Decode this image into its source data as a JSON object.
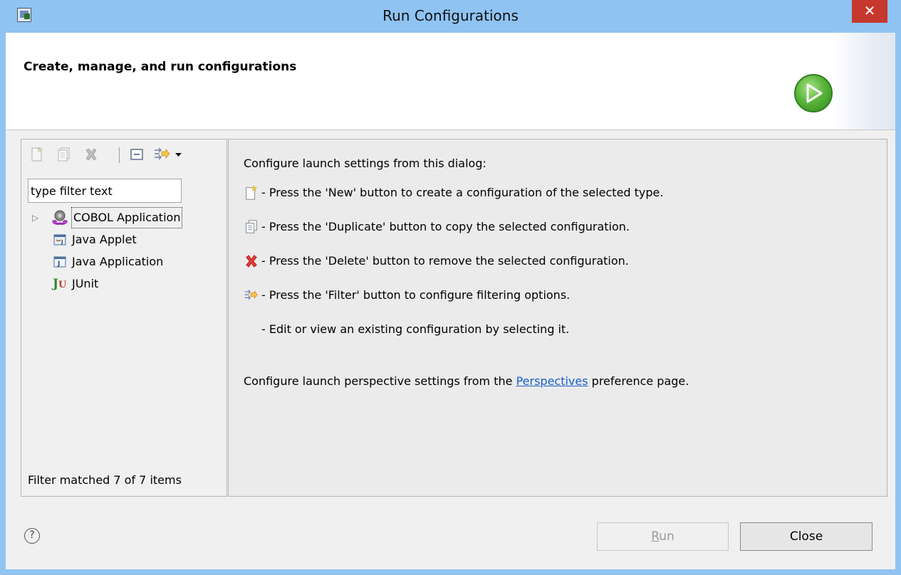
{
  "window": {
    "title": "Run Configurations",
    "close_glyph": "✕"
  },
  "banner": {
    "title": "Create, manage, and run configurations",
    "icon": "run-play-icon"
  },
  "left": {
    "toolbar": [
      {
        "name": "new-launch-configuration-button",
        "icon": "new-config-icon"
      },
      {
        "name": "duplicate-button",
        "icon": "duplicate-icon"
      },
      {
        "name": "delete-button",
        "icon": "delete-icon"
      },
      {
        "name": "collapse-all-button",
        "icon": "collapse-all-icon"
      },
      {
        "name": "filter-button",
        "icon": "filter-icon"
      },
      {
        "name": "filter-menu-dropdown",
        "icon": "chevron-down-icon"
      }
    ],
    "filter_value": "type filter text",
    "tree": [
      {
        "label": "COBOL Application",
        "icon": "cobol-icon",
        "selected": true,
        "expandable": true
      },
      {
        "label": "Java Applet",
        "icon": "java-applet-icon"
      },
      {
        "label": "Java Application",
        "icon": "java-application-icon"
      },
      {
        "label": "JUnit",
        "icon": "junit-icon",
        "icon_text": "Ju"
      }
    ],
    "expander_glyph": "▷",
    "status": "Filter matched 7 of 7 items"
  },
  "right": {
    "intro": "Configure launch settings from this dialog:",
    "lines": [
      {
        "icon": "new-config-icon",
        "text": "- Press the 'New' button to create a configuration of the selected type."
      },
      {
        "icon": "duplicate-icon",
        "text": "- Press the 'Duplicate' button to copy the selected configuration."
      },
      {
        "icon": "delete-icon",
        "text": "- Press the 'Delete' button to remove the selected configuration."
      },
      {
        "icon": "filter-icon",
        "text": "- Press the 'Filter' button to configure filtering options."
      },
      {
        "icon": "",
        "text": "- Edit or view an existing configuration by selecting it."
      }
    ],
    "perspectives_prefix": "Configure launch perspective settings from the ",
    "perspectives_link": "Perspectives",
    "perspectives_suffix": " preference page."
  },
  "footer": {
    "help_glyph": "?",
    "run_label_mnemonic": "R",
    "run_label_rest": "un",
    "close_label": "Close"
  },
  "colors": {
    "titlebar": "#8fc3f2",
    "close": "#c6382e",
    "link": "#1a5fcc"
  }
}
